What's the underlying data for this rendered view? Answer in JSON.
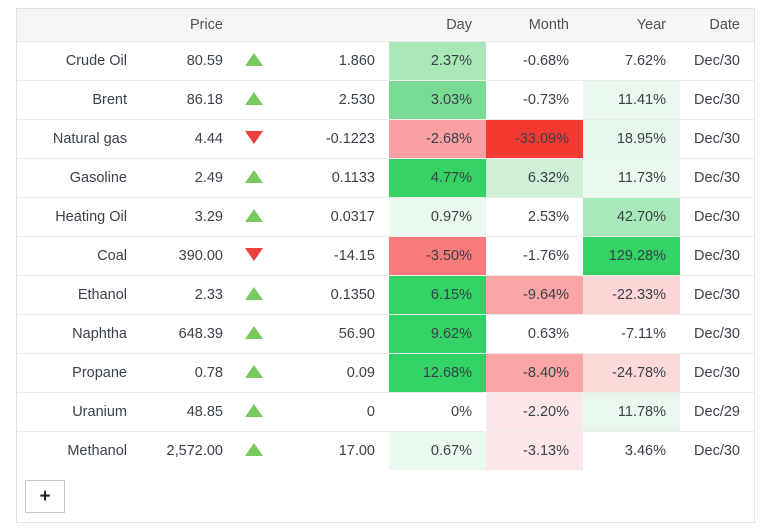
{
  "table": {
    "headers": {
      "name": "",
      "price": "Price",
      "arrow": "",
      "change": "",
      "day": "Day",
      "month": "Month",
      "year": "Year",
      "date": "Date"
    },
    "rows": [
      {
        "name": "Crude Oil",
        "price": "80.59",
        "direction": "up",
        "change": "1.860",
        "day": "2.37%",
        "day_bg": "#abe8b7",
        "month": "-0.68%",
        "month_bg": "#ffffff",
        "year": "7.62%",
        "year_bg": "#ffffff",
        "date": "Dec/30"
      },
      {
        "name": "Brent",
        "price": "86.18",
        "direction": "up",
        "change": "2.530",
        "day": "3.03%",
        "day_bg": "#77db92",
        "month": "-0.73%",
        "month_bg": "#ffffff",
        "year": "11.41%",
        "year_bg": "#eaf8ee",
        "date": "Dec/30"
      },
      {
        "name": "Natural gas",
        "price": "4.44",
        "direction": "down",
        "change": "-0.1223",
        "day": "-2.68%",
        "day_bg": "#faa0a0",
        "month": "-33.09%",
        "month_bg": "#f53a33",
        "year": "18.95%",
        "year_bg": "#e8f7ec",
        "date": "Dec/30"
      },
      {
        "name": "Gasoline",
        "price": "2.49",
        "direction": "up",
        "change": "0.1133",
        "day": "4.77%",
        "day_bg": "#36d163",
        "month": "6.32%",
        "month_bg": "#cdf0d7",
        "year": "11.73%",
        "year_bg": "#eaf8ee",
        "date": "Dec/30"
      },
      {
        "name": "Heating Oil",
        "price": "3.29",
        "direction": "up",
        "change": "0.0317",
        "day": "0.97%",
        "day_bg": "#eaf8ee",
        "month": "2.53%",
        "month_bg": "#ffffff",
        "year": "42.70%",
        "year_bg": "#a8e9ba",
        "date": "Dec/30"
      },
      {
        "name": "Coal",
        "price": "390.00",
        "direction": "down",
        "change": "-14.15",
        "day": "-3.50%",
        "day_bg": "#f97b7b",
        "month": "-1.76%",
        "month_bg": "#ffffff",
        "year": "129.28%",
        "year_bg": "#32d265",
        "date": "Dec/30"
      },
      {
        "name": "Ethanol",
        "price": "2.33",
        "direction": "up",
        "change": "0.1350",
        "day": "6.15%",
        "day_bg": "#32d265",
        "month": "-9.64%",
        "month_bg": "#faa5a5",
        "year": "-22.33%",
        "year_bg": "#fcd6d6",
        "date": "Dec/30"
      },
      {
        "name": "Naphtha",
        "price": "648.39",
        "direction": "up",
        "change": "56.90",
        "day": "9.62%",
        "day_bg": "#32d265",
        "month": "0.63%",
        "month_bg": "#ffffff",
        "year": "-7.11%",
        "year_bg": "#ffffff",
        "date": "Dec/30"
      },
      {
        "name": "Propane",
        "price": "0.78",
        "direction": "up",
        "change": "0.09",
        "day": "12.68%",
        "day_bg": "#32d265",
        "month": "-8.40%",
        "month_bg": "#faa5a5",
        "year": "-24.78%",
        "year_bg": "#fbd9d9",
        "date": "Dec/30"
      },
      {
        "name": "Uranium",
        "price": "48.85",
        "direction": "up",
        "change": "0",
        "day": "0%",
        "day_bg": "#ffffff",
        "month": "-2.20%",
        "month_bg": "#fbe7e7",
        "year": "11.78%",
        "year_bg": "#eaf7ee",
        "date": "Dec/29"
      },
      {
        "name": "Methanol",
        "price": "2,572.00",
        "direction": "up",
        "change": "17.00",
        "day": "0.67%",
        "day_bg": "#eaf8ee",
        "month": "-3.13%",
        "month_bg": "#fbe7e7",
        "year": "3.46%",
        "year_bg": "#ffffff",
        "date": "Dec/30"
      }
    ]
  },
  "footer": {
    "add_button_label": "+"
  },
  "colors": {
    "strong_green": "#32d265",
    "strong_red": "#f53a33",
    "light_green": "#eaf8ee",
    "light_red": "#fbe7e7",
    "up_arrow": "#7ac95f",
    "down_arrow": "#ef3e3e",
    "header_bg": "#f6f6f6",
    "border": "#e8e8e8"
  }
}
